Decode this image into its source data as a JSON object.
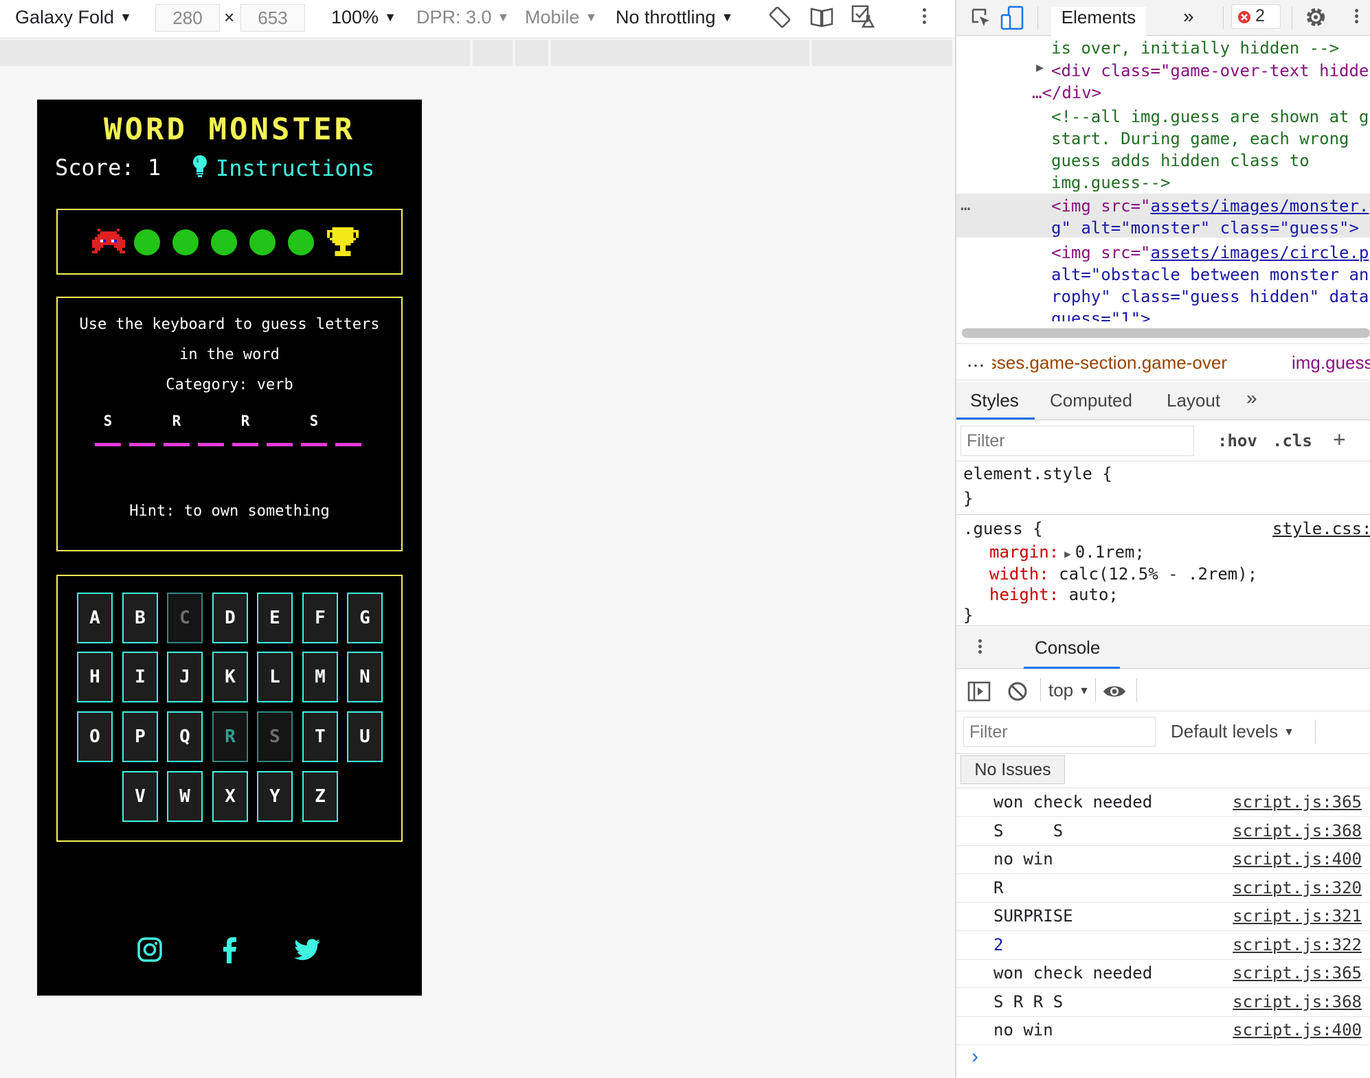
{
  "device_toolbar": {
    "device": "Galaxy Fold",
    "width": "280",
    "height": "653",
    "times": "×",
    "zoom": "100%",
    "dpr": "DPR: 3.0",
    "mode": "Mobile",
    "throttling": "No throttling",
    "icons": [
      "rotate-icon",
      "dual-screen-icon",
      "sensors-icon",
      "more-icon"
    ]
  },
  "game": {
    "title": "WORD MONSTER",
    "score_label": "Score: 1",
    "instructions_label": "Instructions",
    "guesses": {
      "remaining_dots": 5,
      "dot_color": "#22c417"
    },
    "prompt_line1": "Use the keyboard to guess letters",
    "prompt_line2": "in the word",
    "category": "Category: verb",
    "word_slots": [
      "S",
      "",
      "R",
      "",
      "R",
      "",
      "S",
      ""
    ],
    "hint": "Hint: to own something",
    "keyboard": [
      [
        "A",
        "B",
        "C",
        "D",
        "E",
        "F",
        "G"
      ],
      [
        "H",
        "I",
        "J",
        "K",
        "L",
        "M",
        "N"
      ],
      [
        "O",
        "P",
        "Q",
        "R",
        "S",
        "T",
        "U"
      ],
      [
        "V",
        "W",
        "X",
        "Y",
        "Z"
      ]
    ],
    "used_keys": [
      "C",
      "R",
      "S"
    ],
    "social": [
      "instagram-icon",
      "facebook-icon",
      "twitter-icon"
    ],
    "colors": {
      "title": "#f3f354",
      "accent": "#3ff5e0",
      "underline": "#e43bd9"
    }
  },
  "devtools": {
    "tabs": {
      "elements": "Elements",
      "more": "»",
      "errors": "2"
    },
    "dom": {
      "line1": "is over, initially hidden -->",
      "div_open": "<div class=\"game-over-text hidde",
      "div_close": "…</div>",
      "comment1": "<!--all img.guess are shown at g",
      "comment2": "start. During game, each wrong",
      "comment3": "guess adds hidden class to",
      "comment4": "img.guess-->",
      "img1_a": "<img src=\"",
      "img1_link": "assets/images/monster.",
      "img1_b": "g\" alt=\"monster\" class=\"guess\">",
      "img2_a": "<img src=\"",
      "img2_link": "assets/images/circle.p",
      "img2_b": "alt=\"obstacle between monster an",
      "img2_c": "rophy\" class=\"guess hidden\" data",
      "img2_d": "guess=\"1\">",
      "ellipsis": "…"
    },
    "breadcrumb": {
      "dots": "…",
      "item1": "guesses.game-section.game-over",
      "item2": "img.guess"
    },
    "styles_tabs": [
      "Styles",
      "Computed",
      "Layout",
      "»"
    ],
    "styles_filter": {
      "placeholder": "Filter",
      "hov": ":hov",
      "cls": ".cls",
      "add": "+"
    },
    "element_style": {
      "open": "element.style {",
      "close": "}"
    },
    "rule": {
      "selector": ".guess {",
      "source": "style.css:",
      "margin_prop": "margin:",
      "margin_val": "0.1rem;",
      "width_prop": "width:",
      "width_val": "calc(12.5% - .2rem);",
      "height_prop": "height:",
      "height_val": "auto;",
      "close": "}"
    },
    "console": {
      "title": "Console",
      "context": "top",
      "filter_placeholder": "Filter",
      "levels": "Default levels",
      "no_issues": "No Issues",
      "logs": [
        {
          "msg": "won check needed",
          "src": "script.js:365",
          "num": false
        },
        {
          "msg": "S     S",
          "src": "script.js:368",
          "num": false
        },
        {
          "msg": "no win",
          "src": "script.js:400",
          "num": false
        },
        {
          "msg": "R",
          "src": "script.js:320",
          "num": false
        },
        {
          "msg": "SURPRISE",
          "src": "script.js:321",
          "num": false
        },
        {
          "msg": "2",
          "src": "script.js:322",
          "num": true
        },
        {
          "msg": "won check needed",
          "src": "script.js:365",
          "num": false
        },
        {
          "msg": "S R R S",
          "src": "script.js:368",
          "num": false
        },
        {
          "msg": "no win",
          "src": "script.js:400",
          "num": false
        }
      ],
      "prompt": "›"
    }
  }
}
